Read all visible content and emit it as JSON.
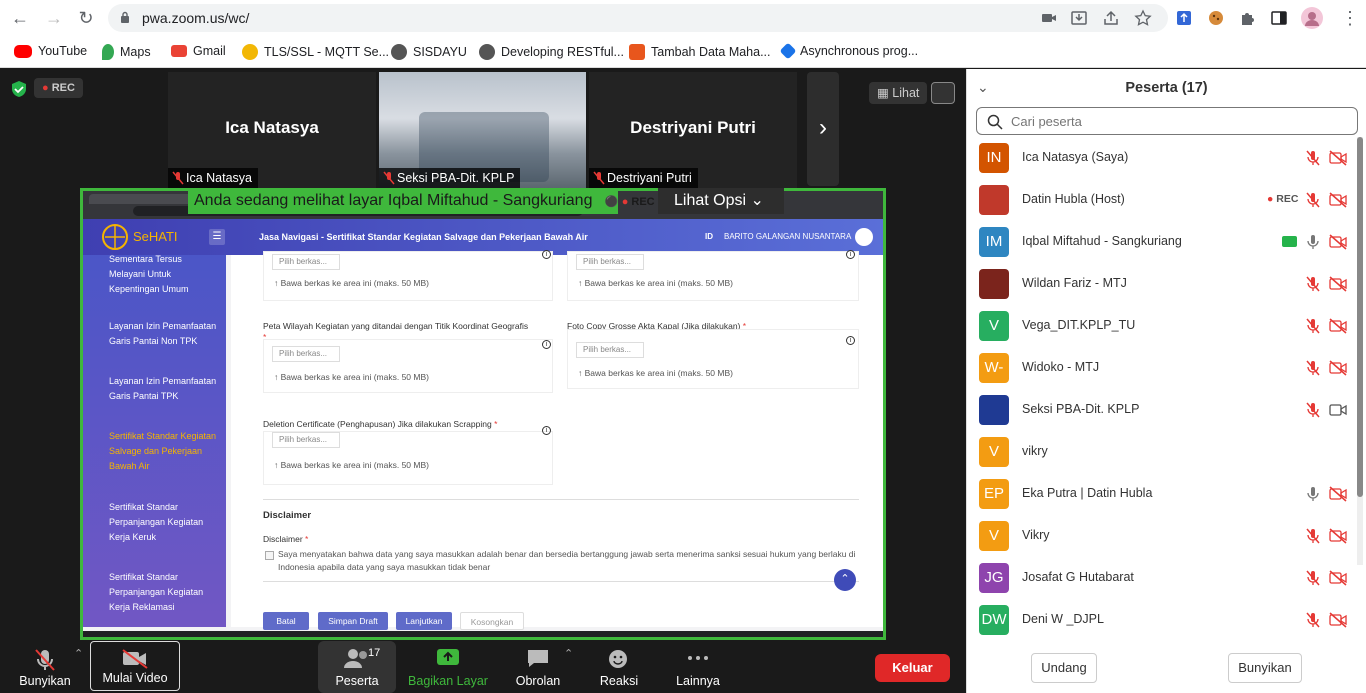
{
  "browser": {
    "url": "pwa.zoom.us/wc/",
    "bookmarks": [
      {
        "label": "YouTube",
        "color": "#ff0000"
      },
      {
        "label": "Maps",
        "color": "#34a853"
      },
      {
        "label": "Gmail",
        "color": "#ea4335"
      },
      {
        "label": "TLS/SSL - MQTT Se...",
        "color": "#f2b705"
      },
      {
        "label": "SISDAYU",
        "color": "#555555"
      },
      {
        "label": "Developing RESTful...",
        "color": "#555555"
      },
      {
        "label": "Tambah Data Maha...",
        "color": "#e8561d"
      },
      {
        "label": "Asynchronous prog...",
        "color": "#1a73e8"
      }
    ]
  },
  "meeting": {
    "rec_badge": "REC",
    "view_label": "Lihat",
    "tiles": [
      {
        "name": "Ica Natasya",
        "tag": "Ica Natasya"
      },
      {
        "name": "",
        "tag": "Seksi PBA-Dit. KPLP"
      },
      {
        "name": "Destriyani Putri",
        "tag": "Destriyani Putri"
      }
    ],
    "share_notice": "Anda sedang melihat layar Iqbal Miftahud - Sangkuriang",
    "share_rec": "REC",
    "share_options": "Lihat Opsi"
  },
  "shared_screen": {
    "brand": "SeHATI",
    "page_title": "Jasa Navigasi - Sertifikat Standar Kegiatan Salvage dan Pekerjaan Bawah Air",
    "id_label": "ID",
    "company": "BARITO GALANGAN NUSANTARA",
    "sidebar_items": [
      {
        "text": "Sementara Tersus Melayani Untuk Kepentingan Umum",
        "active": false
      },
      {
        "text": "Layanan Izin Pemanfaatan Garis Pantai Non TPK",
        "active": false
      },
      {
        "text": "Layanan Izin Pemanfaatan Garis Pantai TPK",
        "active": false
      },
      {
        "text": "Sertifikat Standar Kegiatan Salvage dan Pekerjaan Bawah Air",
        "active": true
      },
      {
        "text": "Sertifikat Standar Perpanjangan Kegiatan Kerja Keruk",
        "active": false
      },
      {
        "text": "Sertifikat Standar Perpanjangan Kegiatan Kerja Reklamasi",
        "active": false
      }
    ],
    "pick_label": "Pilih berkas...",
    "drop_label": "Bawa berkas ke area ini (maks. 50 MB)",
    "field_peta": "Peta Wilayah Kegiatan yang ditandai dengan Titik Koordinat Geografis",
    "field_akta": "Foto Copy Grosse Akta Kapal (Jika dilakukan)",
    "field_deletion": "Deletion Certificate (Penghapusan) Jika dilakukan Scrapping",
    "required_mark": "*",
    "disclaimer_heading": "Disclaimer",
    "disclaimer_label": "Disclaimer",
    "disclaimer_text": "Saya menyatakan bahwa data yang saya masukkan adalah benar dan bersedia bertanggung jawab serta menerima sanksi sesuai hukum yang berlaku di Indonesia apabila data yang saya masukkan tidak benar",
    "btn_batal": "Batal",
    "btn_draft": "Simpan Draft",
    "btn_lanjut": "Lanjutkan",
    "btn_kosong": "Kosongkan"
  },
  "controls": {
    "mute": "Bunyikan",
    "video": "Mulai Video",
    "participants": "Peserta",
    "participants_count": "17",
    "share": "Bagikan Layar",
    "chat": "Obrolan",
    "reactions": "Reaksi",
    "more": "Lainnya",
    "leave": "Keluar"
  },
  "panel": {
    "title": "Peserta (17)",
    "search_placeholder": "Cari peserta",
    "participants": [
      {
        "initials": "IN",
        "name": "Ica Natasya (Saya)",
        "color": "#d35400",
        "mic": "muted",
        "video": "off",
        "rec": "",
        "share": false
      },
      {
        "initials": "",
        "name": "Datin Hubla (Host)",
        "color": "#c0392b",
        "mic": "muted",
        "video": "off",
        "rec": "REC",
        "share": false
      },
      {
        "initials": "IM",
        "name": "Iqbal Miftahud - Sangkuriang",
        "color": "#2e86c1",
        "mic": "on",
        "video": "off",
        "rec": "",
        "share": true
      },
      {
        "initials": "",
        "name": "Wildan Fariz - MTJ",
        "color": "#7b241c",
        "mic": "muted",
        "video": "off",
        "rec": "",
        "share": false
      },
      {
        "initials": "V",
        "name": "Vega_DIT.KPLP_TU",
        "color": "#27ae60",
        "mic": "muted",
        "video": "off",
        "rec": "",
        "share": false
      },
      {
        "initials": "W-",
        "name": "Widoko - MTJ",
        "color": "#f39c12",
        "mic": "muted",
        "video": "off",
        "rec": "",
        "share": false
      },
      {
        "initials": "",
        "name": "Seksi PBA-Dit. KPLP",
        "color": "#1f3a93",
        "mic": "muted",
        "video": "on",
        "rec": "",
        "share": false
      },
      {
        "initials": "V",
        "name": "vikry",
        "color": "#f39c12",
        "mic": "none",
        "video": "none",
        "rec": "",
        "share": false
      },
      {
        "initials": "EP",
        "name": "Eka Putra | Datin Hubla",
        "color": "#f39c12",
        "mic": "on",
        "video": "off",
        "rec": "",
        "share": false
      },
      {
        "initials": "V",
        "name": "Vikry",
        "color": "#f39c12",
        "mic": "muted",
        "video": "off",
        "rec": "",
        "share": false
      },
      {
        "initials": "JG",
        "name": "Josafat G Hutabarat",
        "color": "#8e44ad",
        "mic": "muted",
        "video": "off",
        "rec": "",
        "share": false
      },
      {
        "initials": "DW",
        "name": "Deni W _DJPL",
        "color": "#27ae60",
        "mic": "muted",
        "video": "off",
        "rec": "",
        "share": false
      }
    ],
    "btn_undang": "Undang",
    "btn_bunyikan": "Bunyikan"
  }
}
